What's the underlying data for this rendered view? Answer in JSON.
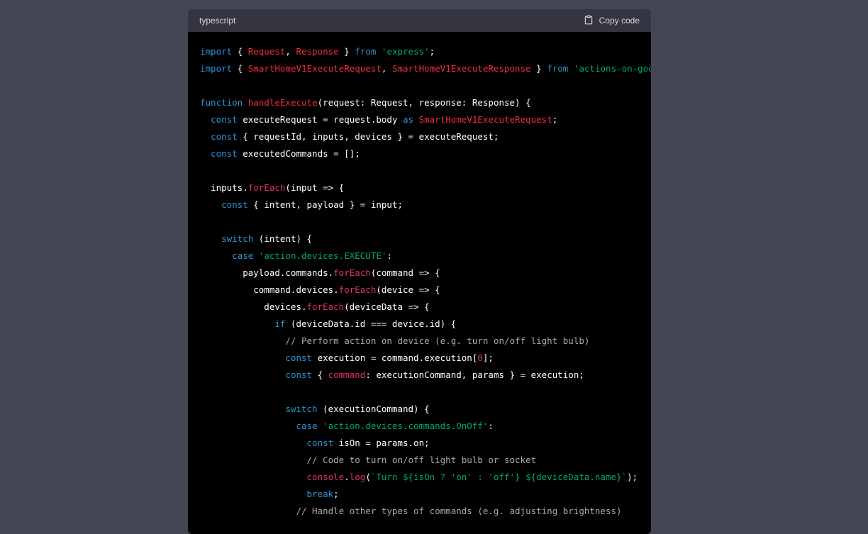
{
  "header": {
    "language": "typescript",
    "copy_label": "Copy code"
  },
  "code_lines": [
    [
      {
        "t": "import",
        "c": "kw"
      },
      {
        "t": " { "
      },
      {
        "t": "Request",
        "c": "ty"
      },
      {
        "t": ", "
      },
      {
        "t": "Response",
        "c": "ty"
      },
      {
        "t": " } "
      },
      {
        "t": "from",
        "c": "kw"
      },
      {
        "t": " "
      },
      {
        "t": "'express'",
        "c": "str"
      },
      {
        "t": ";"
      }
    ],
    [
      {
        "t": "import",
        "c": "kw"
      },
      {
        "t": " { "
      },
      {
        "t": "SmartHomeV1ExecuteRequest",
        "c": "ty"
      },
      {
        "t": ", "
      },
      {
        "t": "SmartHomeV1ExecuteResponse",
        "c": "ty"
      },
      {
        "t": " } "
      },
      {
        "t": "from",
        "c": "kw"
      },
      {
        "t": " "
      },
      {
        "t": "'actions-on-google'",
        "c": "str"
      },
      {
        "t": ";"
      }
    ],
    [],
    [
      {
        "t": "function",
        "c": "kw"
      },
      {
        "t": " "
      },
      {
        "t": "handleExecute",
        "c": "ty"
      },
      {
        "t": "(request: Request, response: Response) {"
      }
    ],
    [
      {
        "t": "  "
      },
      {
        "t": "const",
        "c": "kw"
      },
      {
        "t": " executeRequest = request.body "
      },
      {
        "t": "as",
        "c": "kw"
      },
      {
        "t": " "
      },
      {
        "t": "SmartHomeV1ExecuteRequest",
        "c": "ty"
      },
      {
        "t": ";"
      }
    ],
    [
      {
        "t": "  "
      },
      {
        "t": "const",
        "c": "kw"
      },
      {
        "t": " { requestId, inputs, devices } = executeRequest;"
      }
    ],
    [
      {
        "t": "  "
      },
      {
        "t": "const",
        "c": "kw"
      },
      {
        "t": " executedCommands = [];"
      }
    ],
    [],
    [
      {
        "t": "  inputs."
      },
      {
        "t": "forEach",
        "c": "fn"
      },
      {
        "t": "(input => {"
      }
    ],
    [
      {
        "t": "    "
      },
      {
        "t": "const",
        "c": "kw"
      },
      {
        "t": " { intent, payload } = input;"
      }
    ],
    [],
    [
      {
        "t": "    "
      },
      {
        "t": "switch",
        "c": "kw"
      },
      {
        "t": " (intent) {"
      }
    ],
    [
      {
        "t": "      "
      },
      {
        "t": "case",
        "c": "kw"
      },
      {
        "t": " "
      },
      {
        "t": "'action.devices.EXECUTE'",
        "c": "str"
      },
      {
        "t": ":"
      }
    ],
    [
      {
        "t": "        payload.commands."
      },
      {
        "t": "forEach",
        "c": "fn"
      },
      {
        "t": "(command => {"
      }
    ],
    [
      {
        "t": "          command.devices."
      },
      {
        "t": "forEach",
        "c": "fn"
      },
      {
        "t": "(device => {"
      }
    ],
    [
      {
        "t": "            devices."
      },
      {
        "t": "forEach",
        "c": "fn"
      },
      {
        "t": "(deviceData => {"
      }
    ],
    [
      {
        "t": "              "
      },
      {
        "t": "if",
        "c": "kw"
      },
      {
        "t": " (deviceData.id === device.id) {"
      }
    ],
    [
      {
        "t": "                "
      },
      {
        "t": "// Perform action on device (e.g. turn on/off light bulb)",
        "c": "cm"
      }
    ],
    [
      {
        "t": "                "
      },
      {
        "t": "const",
        "c": "kw"
      },
      {
        "t": " execution = command.execution["
      },
      {
        "t": "0",
        "c": "num"
      },
      {
        "t": "];"
      }
    ],
    [
      {
        "t": "                "
      },
      {
        "t": "const",
        "c": "kw"
      },
      {
        "t": " { "
      },
      {
        "t": "command",
        "c": "fn"
      },
      {
        "t": ": executionCommand, params } = execution;"
      }
    ],
    [],
    [
      {
        "t": "                "
      },
      {
        "t": "switch",
        "c": "kw"
      },
      {
        "t": " (executionCommand) {"
      }
    ],
    [
      {
        "t": "                  "
      },
      {
        "t": "case",
        "c": "kw"
      },
      {
        "t": " "
      },
      {
        "t": "'action.devices.commands.OnOff'",
        "c": "str"
      },
      {
        "t": ":"
      }
    ],
    [
      {
        "t": "                    "
      },
      {
        "t": "const",
        "c": "kw"
      },
      {
        "t": " isOn = params.on;"
      }
    ],
    [
      {
        "t": "                    "
      },
      {
        "t": "// Code to turn on/off light bulb or socket",
        "c": "cm"
      }
    ],
    [
      {
        "t": "                    "
      },
      {
        "t": "console",
        "c": "fn"
      },
      {
        "t": "."
      },
      {
        "t": "log",
        "c": "fn"
      },
      {
        "t": "("
      },
      {
        "t": "`Turn ${isOn ? 'on' : 'off'} ${deviceData.name}`",
        "c": "str"
      },
      {
        "t": ");"
      }
    ],
    [
      {
        "t": "                    "
      },
      {
        "t": "break",
        "c": "kw"
      },
      {
        "t": ";"
      }
    ],
    [
      {
        "t": "                  "
      },
      {
        "t": "// Handle other types of commands (e.g. adjusting brightness)",
        "c": "cm"
      }
    ]
  ],
  "colors": {
    "keyword": "#2e95d3",
    "type": "#f22c3d",
    "function": "#df3079",
    "string": "#00a67d",
    "comment": "#a9a9a9"
  },
  "icons": {
    "copy": "clipboard-icon"
  }
}
